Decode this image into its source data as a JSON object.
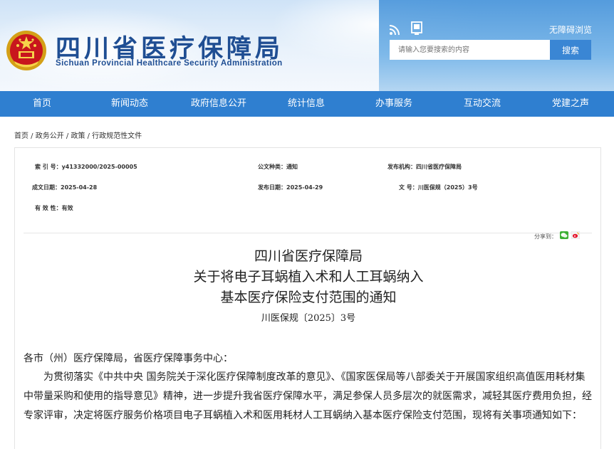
{
  "header": {
    "title": "四川省医疗保障局",
    "subtitle": "Sichuan Provincial Healthcare Security Administration",
    "accessibility": "无障碍浏览",
    "search_placeholder": "请输入您要搜索的内容",
    "search_button": "搜索"
  },
  "nav": {
    "items": [
      "首页",
      "新闻动态",
      "政府信息公开",
      "统计信息",
      "办事服务",
      "互动交流",
      "党建之声"
    ]
  },
  "breadcrumb": "首页 / 政务公开 / 政策 / 行政规范性文件",
  "meta": {
    "index_label": "索 引 号：",
    "index_value": "y41332000/2025-00005",
    "category_label": "公文种类：",
    "category_value": "通知",
    "issuer_label": "发布机构：",
    "issuer_value": "四川省医疗保障局",
    "created_label": "成文日期：",
    "created_value": "2025-04-28",
    "published_label": "发布日期：",
    "published_value": "2025-04-29",
    "docno_label": "文   号：",
    "docno_value": "川医保规（2025）3号",
    "validity_label": "有 效 性：",
    "validity_value": "有效"
  },
  "share": {
    "label": "分享到："
  },
  "document": {
    "title_line1": "四川省医疗保障局",
    "title_line2": "关于将电子耳蜗植入术和人工耳蜗纳入",
    "title_line3": "基本医疗保险支付范围的通知",
    "number": "川医保规〔2025〕3号",
    "salutation": "各市（州）医疗保障局，省医疗保障事务中心：",
    "paragraph": "为贯彻落实《中共中央 国务院关于深化医疗保障制度改革的意见》、《国家医保局等八部委关于开展国家组织高值医用耗材集中带量采购和使用的指导意见》精神，进一步提升我省医疗保障水平，满足参保人员多层次的就医需求，减轻其医疗费用负担，经专家评审，决定将医疗服务价格项目电子耳蜗植入术和医用耗材人工耳蜗纳入基本医疗保险支付范围，现将有关事项通知如下："
  }
}
